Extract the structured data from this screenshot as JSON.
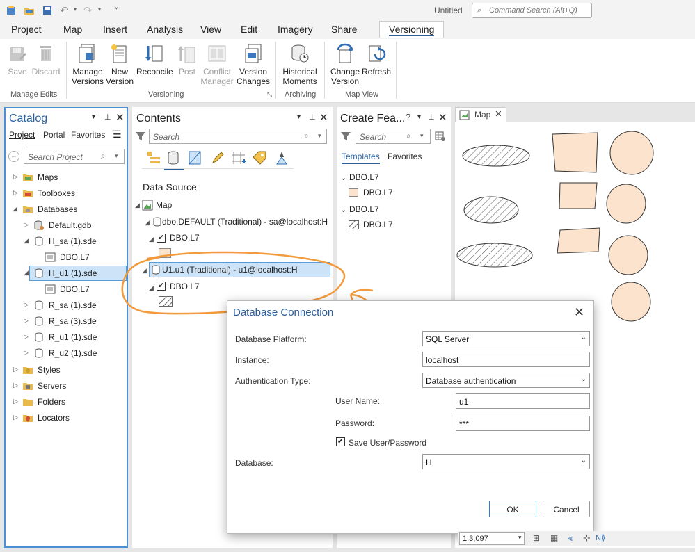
{
  "window": {
    "title": "Untitled",
    "command_search_placeholder": "Command Search (Alt+Q)"
  },
  "ribbon_tabs": [
    "Project",
    "Map",
    "Insert",
    "Analysis",
    "View",
    "Edit",
    "Imagery",
    "Share",
    "Versioning"
  ],
  "active_tab": "Versioning",
  "ribbon": {
    "save": "Save",
    "discard": "Discard",
    "manage_versions": [
      "Manage",
      "Versions"
    ],
    "new_version": [
      "New",
      "Version"
    ],
    "reconcile": "Reconcile",
    "post": "Post",
    "conflict_manager": [
      "Conflict",
      "Manager"
    ],
    "version_changes": [
      "Version",
      "Changes"
    ],
    "historical_moments": [
      "Historical",
      "Moments"
    ],
    "change_version": [
      "Change",
      "Version"
    ],
    "refresh": "Refresh",
    "groups": [
      "Manage Edits",
      "Versioning",
      "Archiving",
      "Map View"
    ]
  },
  "catalog": {
    "title": "Catalog",
    "tabs": [
      "Project",
      "Portal",
      "Favorites"
    ],
    "search_placeholder": "Search Project",
    "items": [
      "Maps",
      "Toolboxes",
      "Databases",
      "Default.gdb",
      "H_sa (1).sde",
      "DBO.L7",
      "H_u1 (1).sde",
      "DBO.L7",
      "R_sa (1).sde",
      "R_sa (3).sde",
      "R_u1 (1).sde",
      "R_u2 (1).sde",
      "Styles",
      "Servers",
      "Folders",
      "Locators"
    ]
  },
  "contents": {
    "title": "Contents",
    "search_placeholder": "Search",
    "heading": "Data Source",
    "map": "Map",
    "conn1": "dbo.DEFAULT (Traditional) - sa@localhost:H",
    "layer1": "DBO.L7",
    "conn2": "U1.u1 (Traditional) - u1@localhost:H",
    "layer2": "DBO.L7"
  },
  "create_features": {
    "title": "Create Fea...",
    "search_placeholder": "Search",
    "tabs": [
      "Templates",
      "Favorites"
    ],
    "groups": [
      "DBO.L7",
      "DBO.L7"
    ],
    "items": [
      "DBO.L7",
      "DBO.L7"
    ]
  },
  "map": {
    "tab": "Map",
    "scale": "1:3,097"
  },
  "dialog": {
    "title": "Database Connection",
    "platform_label": "Database Platform:",
    "platform": "SQL Server",
    "instance_label": "Instance:",
    "instance": "localhost",
    "auth_label": "Authentication Type:",
    "auth": "Database authentication",
    "user_label": "User Name:",
    "user": "u1",
    "password_label": "Password:",
    "password": "***",
    "save_label": "Save User/Password",
    "database_label": "Database:",
    "database": "H",
    "ok": "OK",
    "cancel": "Cancel"
  },
  "colors": {
    "accent": "#2a5e9c",
    "selection": "#cde3f7",
    "feature_fill": "#fbe3cd",
    "annotation": "#f39a3c"
  }
}
